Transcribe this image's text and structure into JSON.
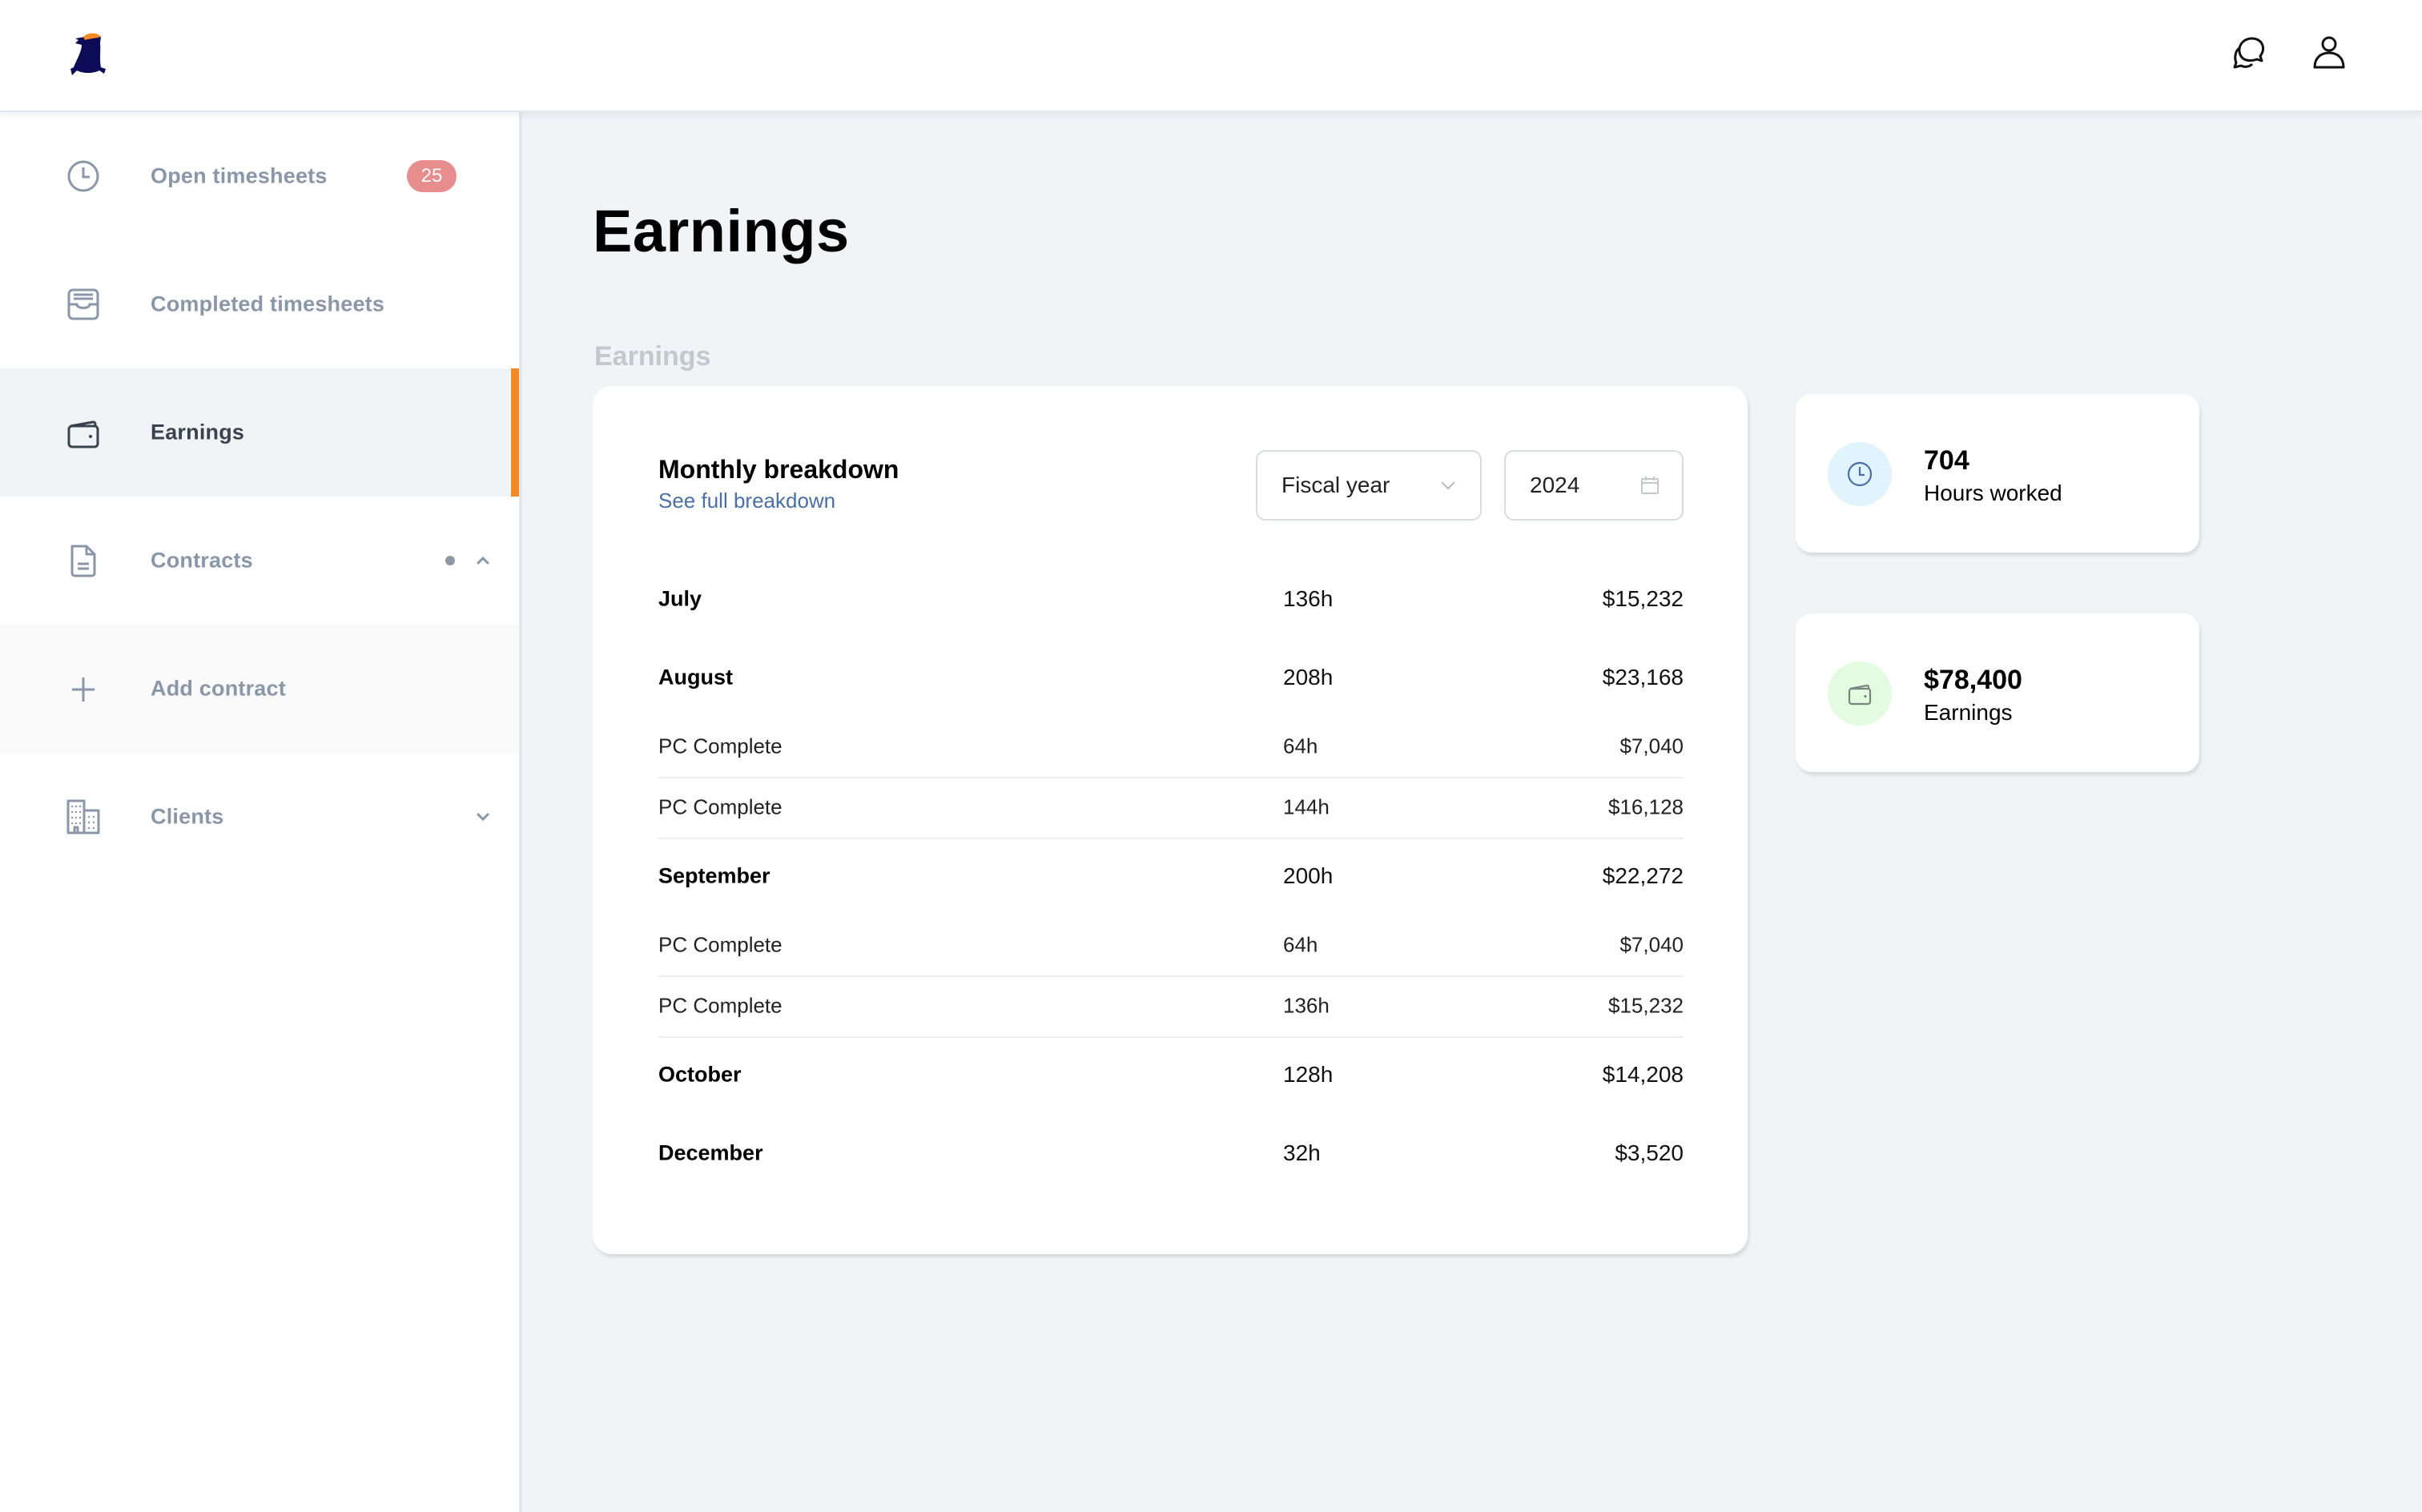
{
  "header": {
    "logo": "mascot-logo",
    "icons": [
      "chat-icon",
      "user-icon"
    ]
  },
  "sidebar": {
    "items": [
      {
        "label": "Open timesheets",
        "icon": "clock-icon",
        "badge": "25",
        "active": false
      },
      {
        "label": "Completed timesheets",
        "icon": "inbox-icon",
        "active": false
      },
      {
        "label": "Earnings",
        "icon": "wallet-icon",
        "active": true
      },
      {
        "label": "Contracts",
        "icon": "document-icon",
        "expanded": true,
        "indicator": "dot"
      },
      {
        "label": "Add contract",
        "icon": "plus-icon",
        "sub_item": true
      },
      {
        "label": "Clients",
        "icon": "building-icon",
        "expanded": false
      }
    ]
  },
  "colors": {
    "accent": "#f58a23",
    "badge": "#e78d8d",
    "link": "#4a6fa5",
    "page_bg": "#f0f4f7",
    "hours_icon_bg": "#e1f3fd",
    "earnings_icon_bg": "#e3fbe0"
  },
  "main": {
    "title": "Earnings",
    "section_label": "Earnings",
    "breakdown": {
      "title": "Monthly breakdown",
      "link": "See full breakdown",
      "period_select": "Fiscal year",
      "year_input": "2024",
      "rows": [
        {
          "type": "month",
          "name": "July",
          "hours": "136h",
          "amount": "$15,232"
        },
        {
          "type": "month",
          "name": "August",
          "hours": "208h",
          "amount": "$23,168"
        },
        {
          "type": "sub",
          "name": "PC Complete",
          "hours": "64h",
          "amount": "$7,040"
        },
        {
          "type": "sub",
          "name": "PC Complete",
          "hours": "144h",
          "amount": "$16,128"
        },
        {
          "type": "month",
          "name": "September",
          "hours": "200h",
          "amount": "$22,272"
        },
        {
          "type": "sub",
          "name": "PC Complete",
          "hours": "64h",
          "amount": "$7,040"
        },
        {
          "type": "sub",
          "name": "PC Complete",
          "hours": "136h",
          "amount": "$15,232"
        },
        {
          "type": "month",
          "name": "October",
          "hours": "128h",
          "amount": "$14,208"
        },
        {
          "type": "month",
          "name": "December",
          "hours": "32h",
          "amount": "$3,520"
        }
      ]
    },
    "stats": [
      {
        "value": "704",
        "label": "Hours worked",
        "icon": "clock-icon"
      },
      {
        "value": "$78,400",
        "label": "Earnings",
        "icon": "wallet-icon"
      }
    ]
  }
}
